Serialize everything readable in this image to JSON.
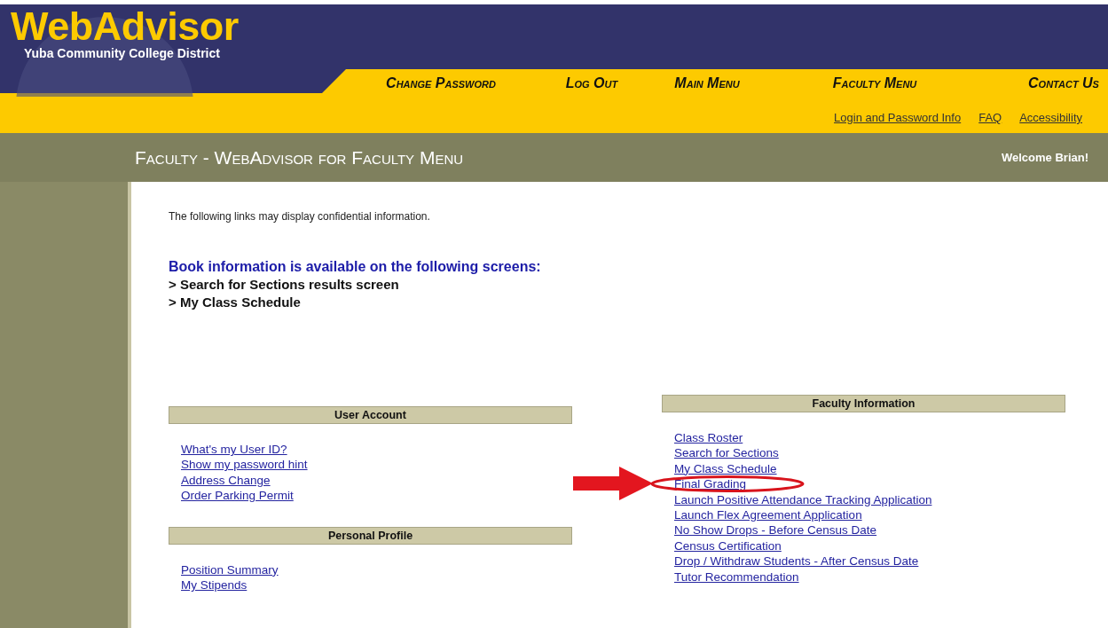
{
  "logo": {
    "title": "WebAdvisor",
    "subtitle": "Yuba Community College District"
  },
  "nav": [
    "Change Password",
    "Log Out",
    "Main Menu",
    "Faculty Menu",
    "Contact Us"
  ],
  "sub_links": [
    "Login and Password Info",
    "FAQ",
    "Accessibility"
  ],
  "page_title": "Faculty - WebAdvisor for Faculty Menu",
  "welcome": "Welcome Brian!",
  "notice": "The following links may display confidential information.",
  "book_info": {
    "heading": "Book information is available on the following screens:",
    "items": [
      "> Search for Sections results screen",
      "> My Class Schedule"
    ]
  },
  "left_sections": [
    {
      "title": "User Account",
      "links": [
        "What's my User ID?",
        "Show my password hint",
        "Address Change",
        "Order Parking Permit"
      ]
    },
    {
      "title": "Personal Profile",
      "links": [
        "Position Summary",
        "My Stipends"
      ]
    }
  ],
  "faculty_section": {
    "title": "Faculty Information",
    "links": [
      {
        "text": "Class Roster",
        "highlighted": false
      },
      {
        "text": "Search for Sections",
        "highlighted": false
      },
      {
        "text": "My Class Schedule",
        "highlighted": false
      },
      {
        "text": "Final Grading",
        "highlighted": true
      },
      {
        "text": "Launch Positive Attendance Tracking Application",
        "highlighted": false
      },
      {
        "text": "Launch Flex Agreement Application",
        "highlighted": false
      },
      {
        "text": "No Show Drops - Before Census Date",
        "highlighted": false
      },
      {
        "text": "Census Certification",
        "highlighted": false
      },
      {
        "text": "Drop / Withdraw Students - After Census Date",
        "highlighted": false
      },
      {
        "text": "Tutor Recommendation",
        "highlighted": false
      }
    ]
  }
}
